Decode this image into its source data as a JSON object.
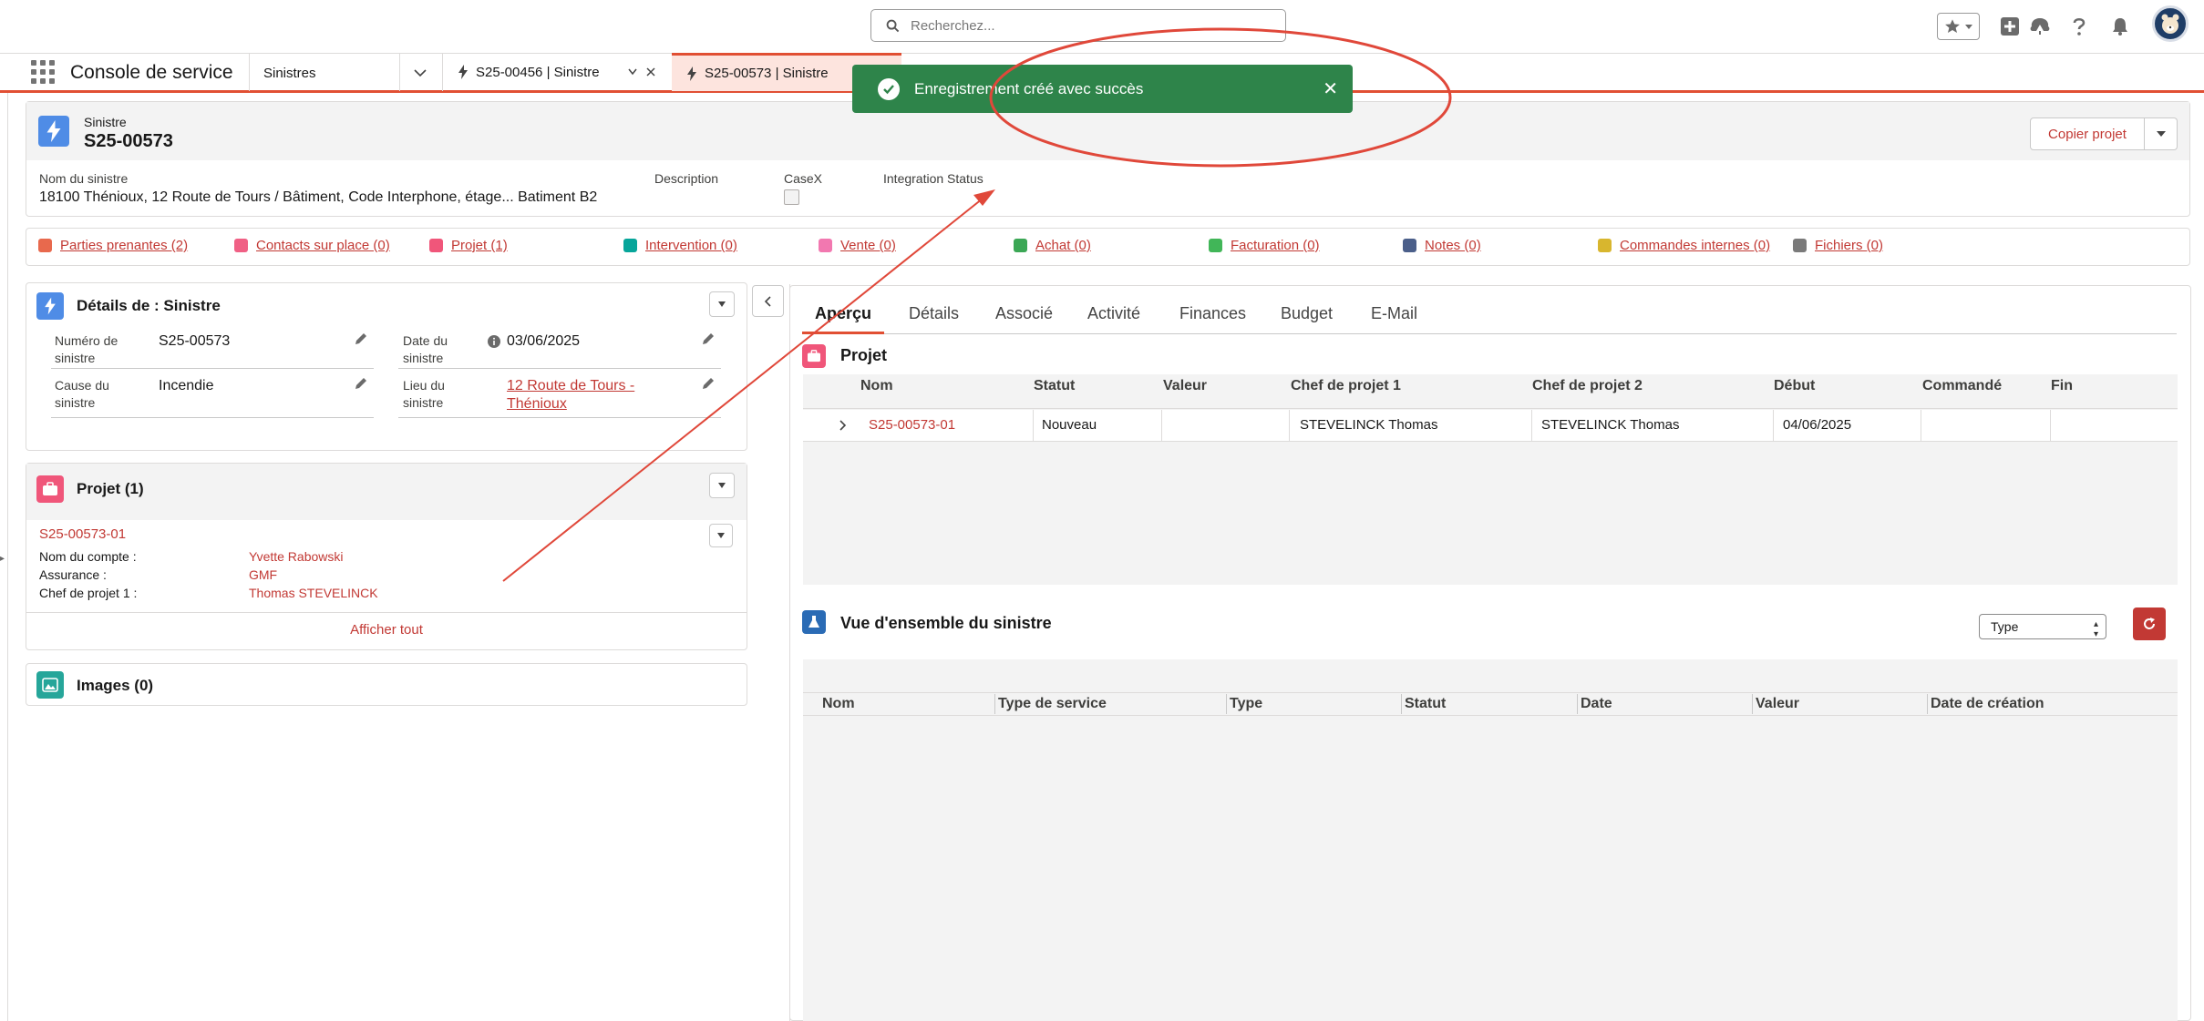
{
  "header": {
    "search_placeholder": "Recherchez..."
  },
  "nav": {
    "app_name": "Console de service",
    "object_selector": "Sinistres",
    "tabs": [
      {
        "label": "S25-00456 | Sinistre"
      },
      {
        "label": "S25-00573 | Sinistre"
      }
    ]
  },
  "toast": {
    "message": "Enregistrement créé avec succès",
    "color": "#2e844a"
  },
  "record": {
    "object_label": "Sinistre",
    "title": "S25-00573",
    "copy_button": "Copier projet",
    "fields": [
      {
        "label": "Nom du sinistre",
        "value": "18100 Thénioux, 12 Route de Tours / Bâtiment, Code Interphone, étage... Batiment B2"
      },
      {
        "label": "Description",
        "value": ""
      },
      {
        "label": "CaseX",
        "value": ""
      },
      {
        "label": "Integration Status",
        "value": ""
      }
    ]
  },
  "related": [
    {
      "label": "Parties prenantes (2)",
      "color": "#e8694d"
    },
    {
      "label": "Contacts sur place (0)",
      "color": "#f06085"
    },
    {
      "label": "Projet (1)",
      "color": "#f0567a"
    },
    {
      "label": "Intervention (0)",
      "color": "#06a59a"
    },
    {
      "label": "Vente (0)",
      "color": "#f278b0"
    },
    {
      "label": "Achat (0)",
      "color": "#3ba755"
    },
    {
      "label": "Facturation (0)",
      "color": "#41b658"
    },
    {
      "label": "Notes (0)",
      "color": "#4b5f8a"
    },
    {
      "label": "Commandes internes (0)",
      "color": "#d8b62e"
    },
    {
      "label": "Fichiers (0)",
      "color": "#7a7a7a"
    }
  ],
  "details": {
    "title": "Détails de : Sinistre",
    "numero_label_1": "Numéro de",
    "numero_label_2": "sinistre",
    "numero_value": "S25-00573",
    "date_label_1": "Date du",
    "date_label_2": "sinistre",
    "date_value": "03/06/2025",
    "cause_label_1": "Cause du",
    "cause_label_2": "sinistre",
    "cause_value": "Incendie",
    "lieu_label_1": "Lieu du",
    "lieu_label_2": "sinistre",
    "lieu_value_1": "12 Route de Tours -",
    "lieu_value_2": "Thénioux"
  },
  "project_card": {
    "title": "Projet (1)",
    "item_name": "S25-00573-01",
    "rows": [
      {
        "label": "Nom du compte :",
        "value": "Yvette Rabowski"
      },
      {
        "label": "Assurance :",
        "value": "GMF"
      },
      {
        "label": "Chef de projet 1 :",
        "value": "Thomas STEVELINCK"
      }
    ],
    "view_all": "Afficher tout"
  },
  "images_card": {
    "title": "Images (0)"
  },
  "right_tabs": [
    "Aperçu",
    "Détails",
    "Associé",
    "Activité",
    "Finances",
    "Budget",
    "E-Mail"
  ],
  "project_section": {
    "title": "Projet",
    "columns": [
      "Nom",
      "Statut",
      "Valeur",
      "Chef de projet 1",
      "Chef de projet 2",
      "Début",
      "Commandé",
      "Fin"
    ],
    "row": [
      "S25-00573-01",
      "Nouveau",
      "",
      "STEVELINCK Thomas",
      "STEVELINCK Thomas",
      "04/06/2025",
      "",
      ""
    ]
  },
  "overview_section": {
    "title": "Vue d'ensemble du sinistre",
    "type_select": "Type",
    "columns": [
      "Nom",
      "Type de service",
      "Type",
      "Statut",
      "Date",
      "Valeur",
      "Date de création"
    ]
  },
  "colors": {
    "accent": "#c23934",
    "nav_underline": "#e14f33",
    "annotation": "#e0483a"
  }
}
